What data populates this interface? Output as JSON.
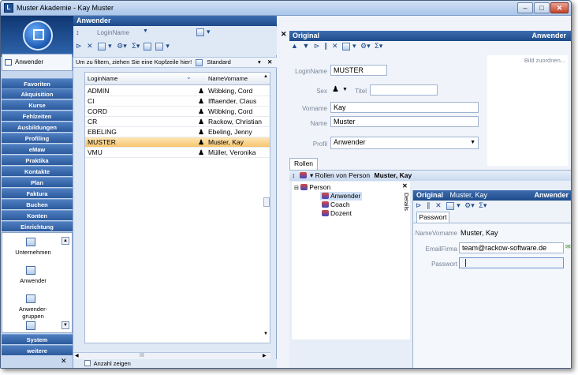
{
  "window": {
    "title": "Muster Akademie - Kay Muster",
    "min": "–",
    "max": "□",
    "close": "✕"
  },
  "nav": {
    "current": "Anwender",
    "categories": [
      "Favoriten",
      "Akquisition",
      "Kurse",
      "Fehlzeiten",
      "Ausbildungen",
      "Profiling",
      "eMaw",
      "Praktika",
      "Kontakte",
      "Plan",
      "Faktura",
      "Buchen",
      "Konten",
      "Einrichtung"
    ],
    "pane_items": [
      "Unternehmen",
      "Anwender",
      "Anwender-\ngruppen"
    ],
    "bottom_categories": [
      "System",
      "weitere"
    ],
    "close": "✕"
  },
  "list": {
    "header": "Anwender",
    "close": "✕",
    "search_field": "LoginName",
    "group_hint": "Um zu filtern, ziehen Sie eine Kopfzeile hier!",
    "layout_label": "Standard",
    "columns": {
      "login": "LoginName",
      "name": "NameVorname"
    },
    "rows": [
      {
        "login": "ADMIN",
        "name": "Wöbking, Cord",
        "selected": false
      },
      {
        "login": "CI",
        "name": "Ifflaender, Claus",
        "selected": false
      },
      {
        "login": "CORD",
        "name": "Wöbking, Cord",
        "selected": false
      },
      {
        "login": "CR",
        "name": "Rackow, Christian",
        "selected": false
      },
      {
        "login": "EBELING",
        "name": "Ebeling, Jenny",
        "selected": false
      },
      {
        "login": "MUSTER",
        "name": "Muster, Kay",
        "selected": true
      },
      {
        "login": "VMU",
        "name": "Müller, Veronika",
        "selected": false
      }
    ],
    "show_count": "Anzahl zeigen",
    "scroll_label": "III"
  },
  "detail": {
    "mode": "Original",
    "header_right": "Anwender",
    "close": "✕",
    "photo_hint": "Bild zuordnen...",
    "labels": {
      "login": "LoginName",
      "sex": "Sex",
      "title": "Titel",
      "first": "Vorname",
      "last": "Name",
      "profile": "Profil"
    },
    "values": {
      "login": "MUSTER",
      "first": "Kay",
      "last": "Muster",
      "profile": "Anwender",
      "title": ""
    },
    "tab": "Rollen",
    "roles_caption": "Rollen von Person",
    "roles_person": "Muster, Kay",
    "tree": {
      "root": "Person",
      "children": [
        "Anwender",
        "Coach",
        "Dozent"
      ]
    },
    "details_label": "Details",
    "sub": {
      "mode": "Original",
      "person": "Muster, Kay",
      "header_right": "Anwender",
      "tab": "Passwort",
      "labels": {
        "name": "NameVorname",
        "email": "EmailFirma",
        "password": "Passwort"
      },
      "values": {
        "name": "Muster, Kay",
        "email": "team@rackow-software.de",
        "password": ""
      }
    }
  }
}
